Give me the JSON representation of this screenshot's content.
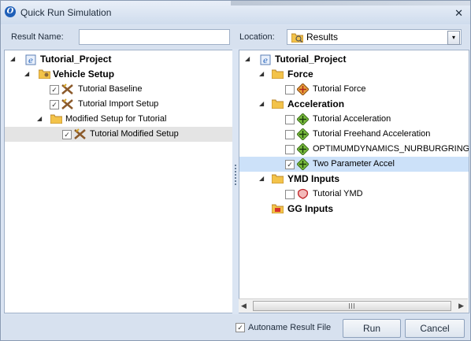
{
  "window": {
    "title": "Quick Run Simulation",
    "close_glyph": "✕",
    "app_icon_glyph": "O"
  },
  "header": {
    "result_name_label": "Result Name:",
    "result_name_value": "",
    "location_label": "Location:",
    "location_value": "Results",
    "dropdown_glyph": "▾"
  },
  "left_tree": {
    "project": "Tutorial_Project",
    "vehicle_setup": "Vehicle Setup",
    "items": [
      "Tutorial Baseline",
      "Tutorial Import Setup"
    ],
    "modified_folder": "Modified Setup for Tutorial",
    "modified_item": "Tutorial Modified Setup"
  },
  "right_tree": {
    "project": "Tutorial_Project",
    "force_group": "Force",
    "force_items": [
      "Tutorial Force"
    ],
    "accel_group": "Acceleration",
    "accel_items": [
      "Tutorial Acceleration",
      "Tutorial Freehand Acceleration",
      "OPTIMUMDYNAMICS_NURBURGRING",
      "Two Parameter Accel"
    ],
    "ymd_group": "YMD Inputs",
    "ymd_items": [
      "Tutorial YMD"
    ],
    "gg_group": "GG Inputs"
  },
  "glyphs": {
    "expanded": "◢",
    "checked": "✓",
    "scroll_left": "◀",
    "scroll_right": "▶"
  },
  "footer": {
    "autoname_label": "Autoname Result File",
    "run_label": "Run",
    "cancel_label": "Cancel"
  },
  "icons": [
    "app-logo-icon",
    "close-icon",
    "folder-icon",
    "project-icon",
    "setup-icon",
    "force-icon",
    "accel-icon",
    "ymd-icon",
    "gg-icon"
  ],
  "colors": {
    "accent": "#cce1f9",
    "folder": "#f3c34a",
    "chrome": "#d7e1ef"
  }
}
